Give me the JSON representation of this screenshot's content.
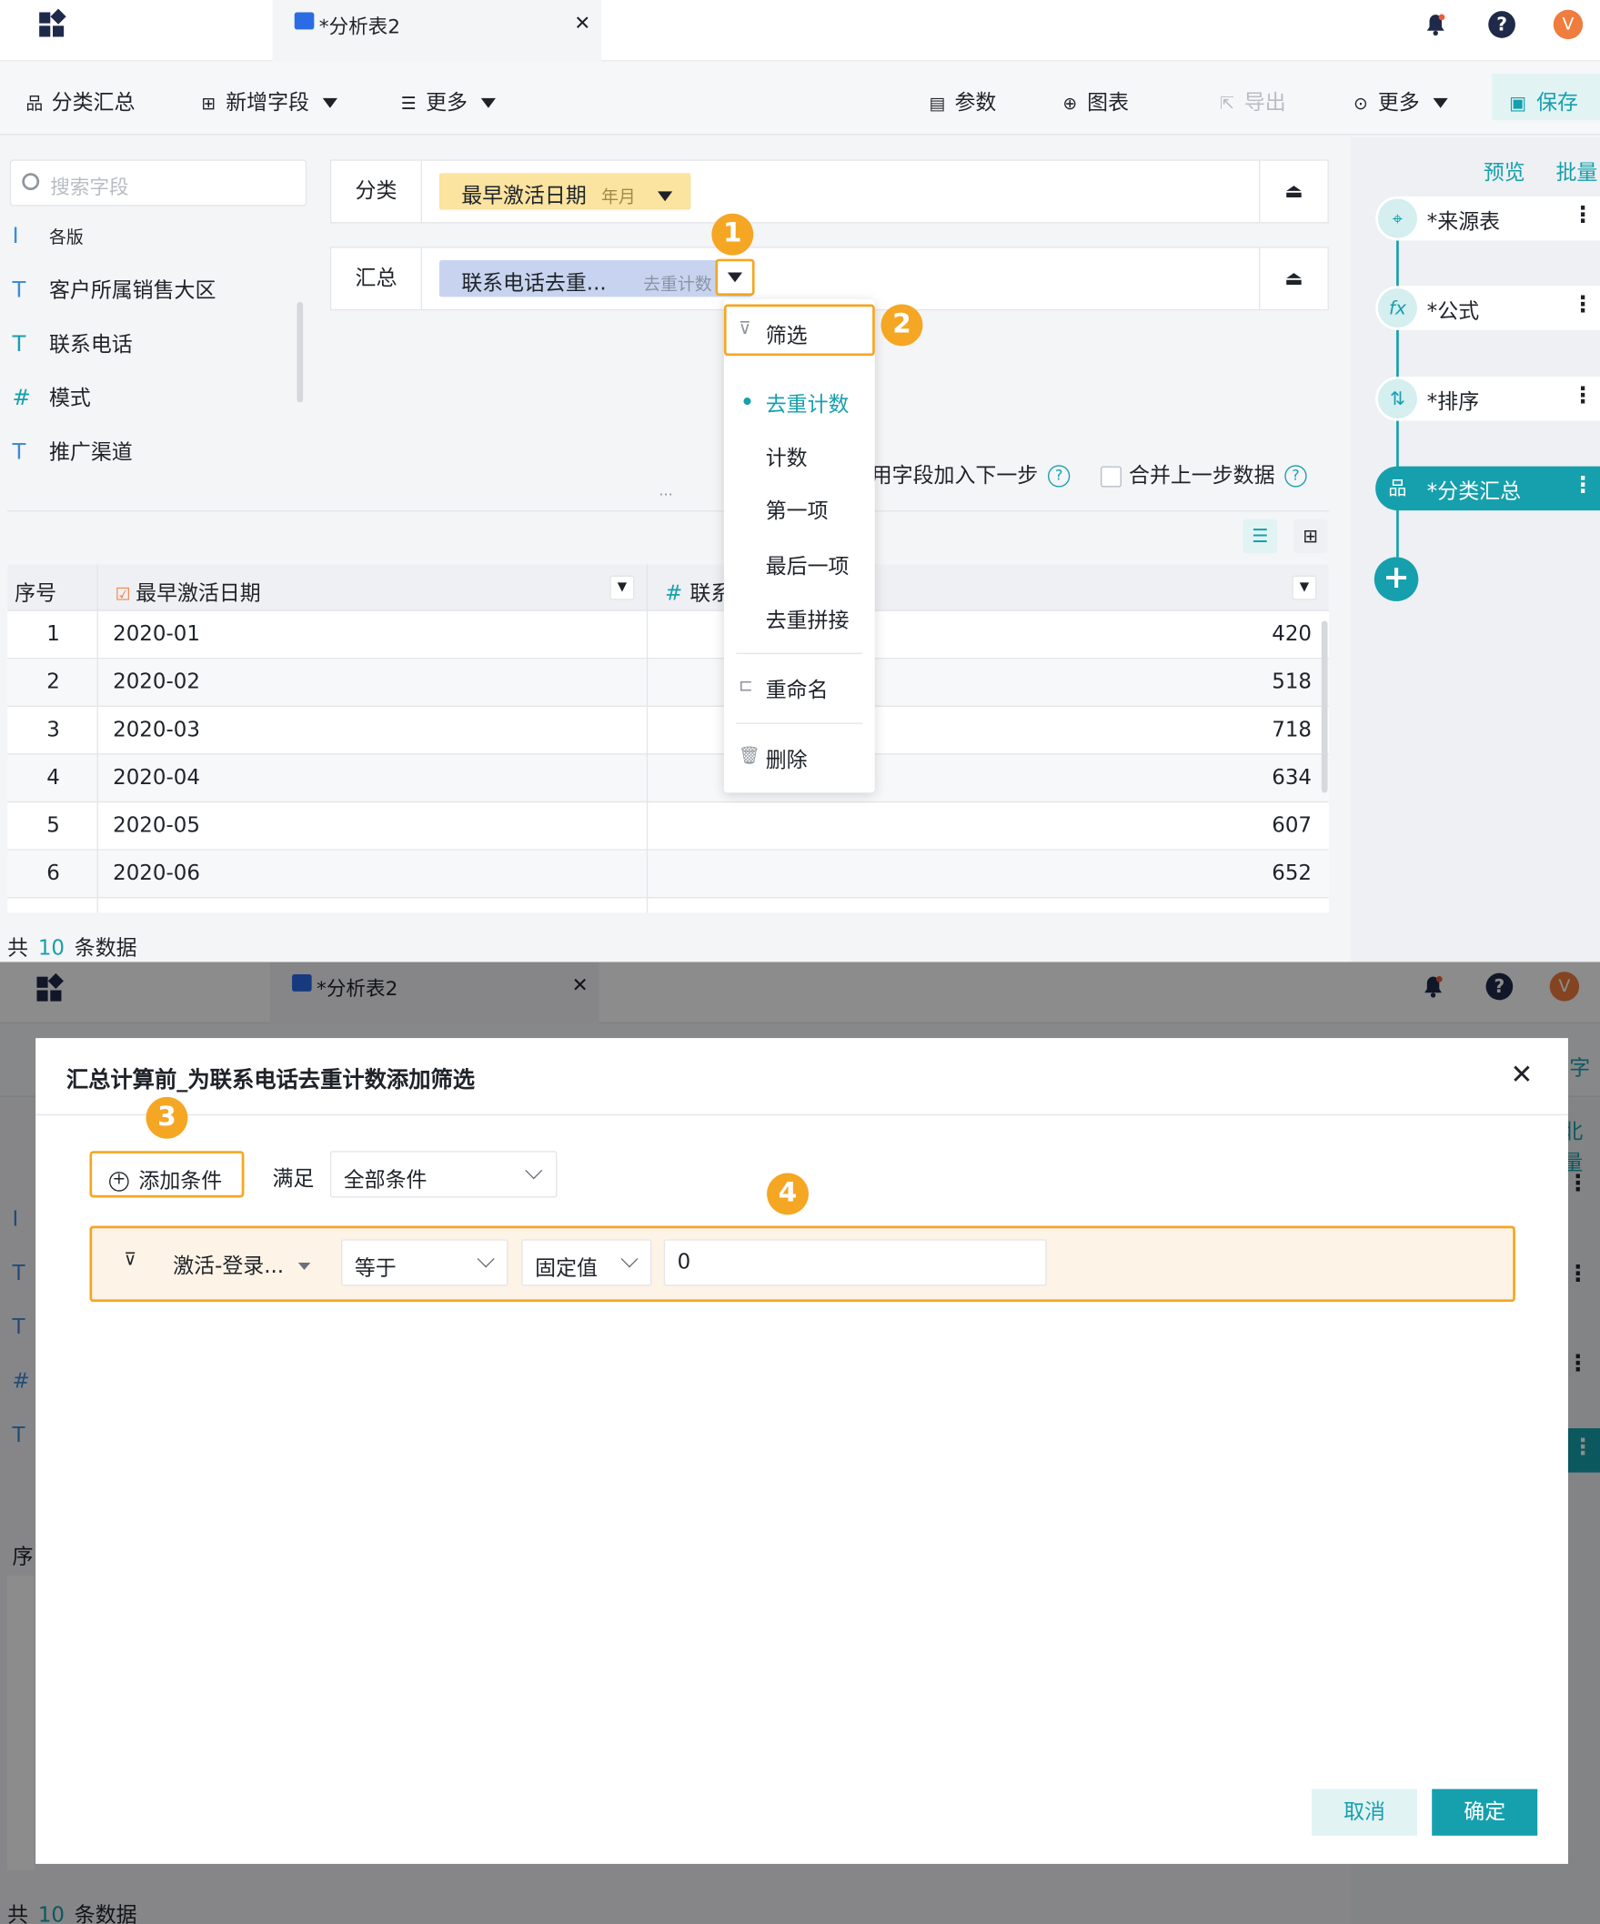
{
  "app": {
    "tab_title": "*分析表2",
    "avatar_initial": "V"
  },
  "toolbar": {
    "group_summary": "分类汇总",
    "add_field": "新增字段",
    "more_left": "更多",
    "params": "参数",
    "chart": "图表",
    "export": "导出",
    "more_right": "更多",
    "save": "保存"
  },
  "fields_panel": {
    "search_placeholder": "搜索字段",
    "items": [
      {
        "type": "I",
        "label": "各版"
      },
      {
        "type": "T",
        "label": "客户所属销售大区"
      },
      {
        "type": "T",
        "label": "联系电话"
      },
      {
        "type": "#",
        "label": "模式"
      },
      {
        "type": "T",
        "label": "推广渠道"
      }
    ]
  },
  "config": {
    "category_label": "分类",
    "category_field": "最早激活日期",
    "category_granularity": "年月",
    "summary_label": "汇总",
    "summary_field": "联系电话去重...",
    "summary_method": "去重计数"
  },
  "options": {
    "use_fields_next": "用字段加入下一步",
    "merge_previous": "合并上一步数据"
  },
  "table": {
    "headers": [
      "序号",
      "最早激活日期",
      "联系"
    ],
    "rows": [
      {
        "idx": "1",
        "date": "2020-01",
        "value": "420"
      },
      {
        "idx": "2",
        "date": "2020-02",
        "value": "518"
      },
      {
        "idx": "3",
        "date": "2020-03",
        "value": "718"
      },
      {
        "idx": "4",
        "date": "2020-04",
        "value": "634"
      },
      {
        "idx": "5",
        "date": "2020-05",
        "value": "607"
      },
      {
        "idx": "6",
        "date": "2020-06",
        "value": "652"
      }
    ],
    "footer_prefix": "共",
    "footer_count": "10",
    "footer_suffix": "条数据"
  },
  "dropdown": {
    "filter": "筛选",
    "methods": [
      "去重计数",
      "计数",
      "第一项",
      "最后一项",
      "去重拼接"
    ],
    "active_method": "去重计数",
    "rename": "重命名",
    "delete": "删除"
  },
  "flow": {
    "preview": "预览",
    "batch": "批量",
    "nodes": [
      "*来源表",
      "*公式",
      "*排序",
      "*分类汇总"
    ]
  },
  "annotations": [
    "1",
    "2",
    "3",
    "4"
  ],
  "modal": {
    "title": "汇总计算前_为联系电话去重计数添加筛选",
    "add_condition": "添加条件",
    "satisfy_label": "满足",
    "satisfy_value": "全部条件",
    "condition": {
      "field": "激活-登录...",
      "operator": "等于",
      "value_type": "固定值",
      "value": "0"
    },
    "cancel": "取消",
    "ok": "确定"
  },
  "bottom_bg": {
    "tab_title": "*分析表2",
    "footer_prefix": "共",
    "footer_count": "10",
    "footer_suffix": "条数据",
    "right_fragment_1": "字",
    "right_fragment_2": "北量",
    "table_fragment": "序"
  },
  "colors": {
    "accent": "#16a0ad",
    "annotation": "#f5a623",
    "category_chip": "#fbe3a0",
    "summary_chip": "#c8d4ef"
  }
}
